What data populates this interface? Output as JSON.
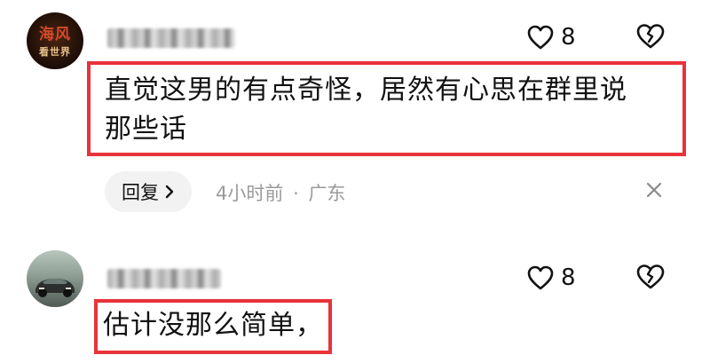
{
  "comments": [
    {
      "avatar": {
        "line1": "海风",
        "line2": "看世界"
      },
      "like_count": "8",
      "lines": [
        "直觉这男的有点奇怪，居然有心思在群里说",
        "那些话"
      ],
      "reply_label": "回复",
      "time": "4小时前",
      "separator": "·",
      "location": "广东"
    },
    {
      "like_count": "8",
      "lines": [
        "估计没那么简单，"
      ]
    }
  ],
  "colors": {
    "highlight": "#e8333b",
    "meta_text": "#9a9a9a",
    "pill_bg": "#f2f2f2"
  },
  "icons": [
    "heart-outline-icon",
    "broken-heart-icon",
    "chevron-right-icon",
    "close-icon"
  ]
}
